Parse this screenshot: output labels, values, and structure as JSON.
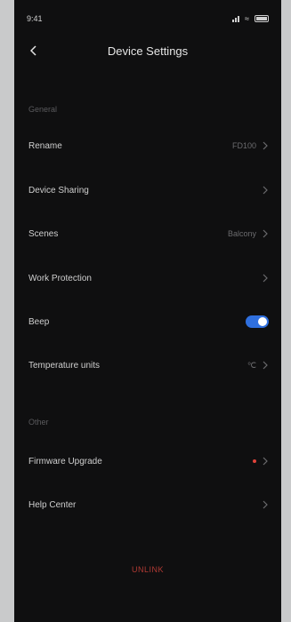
{
  "status_bar": {
    "time": "9:41"
  },
  "header": {
    "title": "Device Settings"
  },
  "sections": {
    "general": {
      "label": "General",
      "rename": {
        "label": "Rename",
        "value": "FD100"
      },
      "device_sharing": {
        "label": "Device Sharing"
      },
      "scenes": {
        "label": "Scenes",
        "value": "Balcony"
      },
      "work_protection": {
        "label": "Work Protection"
      },
      "beep": {
        "label": "Beep",
        "enabled": true
      },
      "temperature_units": {
        "label": "Temperature units",
        "value": "℃"
      }
    },
    "other": {
      "label": "Other",
      "firmware_upgrade": {
        "label": "Firmware Upgrade",
        "has_update": true
      },
      "help_center": {
        "label": "Help Center"
      }
    }
  },
  "footer": {
    "unlink_label": "UNLINK"
  },
  "colors": {
    "accent": "#2f6fde",
    "danger": "#b13a34",
    "update_dot": "#e0433a",
    "background": "#0f0f10"
  },
  "icons": {
    "back": "chevron-left-icon",
    "row_chevron": "chevron-right-icon"
  }
}
